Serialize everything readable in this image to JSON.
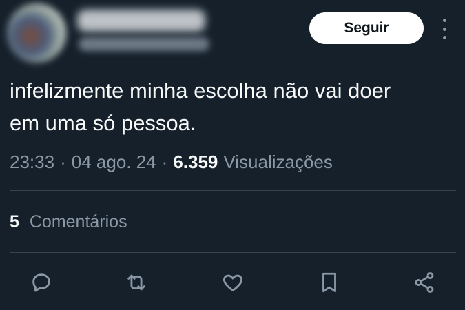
{
  "tweet": {
    "follow_label": "Seguir",
    "text": "infelizmente minha escolha não vai doer\nem uma só pessoa.",
    "time": "23:33",
    "date": "04 ago. 24",
    "views_count": "6.359",
    "views_label": "Visualizações",
    "comments_count": "5",
    "comments_label": "Comentários"
  },
  "actions": [
    {
      "icon": "reply-icon"
    },
    {
      "icon": "retweet-icon"
    },
    {
      "icon": "like-icon"
    },
    {
      "icon": "bookmark-icon"
    },
    {
      "icon": "share-icon"
    }
  ],
  "colors": {
    "background": "#15202b",
    "text": "#f7f9f9",
    "muted": "#8b98a5",
    "divider": "#38444d",
    "button_bg": "#ffffff"
  }
}
